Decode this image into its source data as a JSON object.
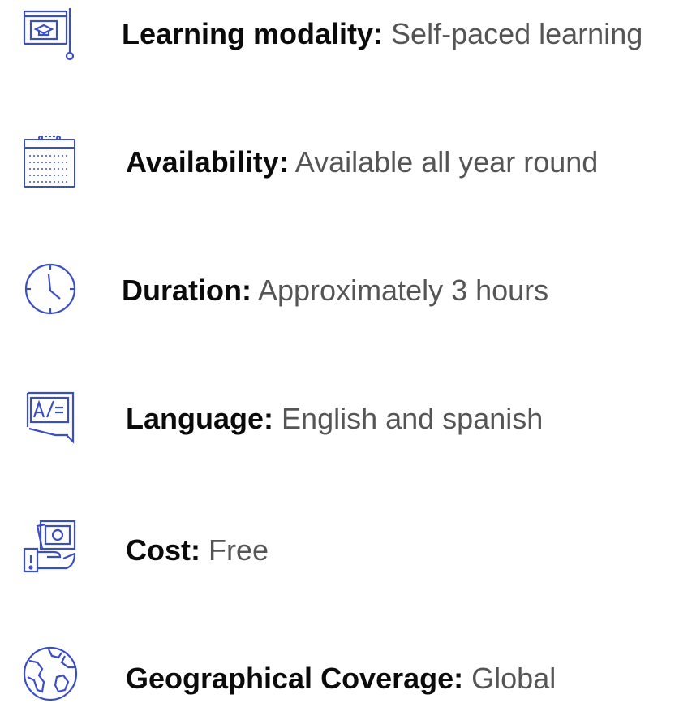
{
  "accent_color": "#3a4fc4",
  "items": [
    {
      "icon": "certificate-screen-icon",
      "label": "Learning modality:",
      "value": "Self-paced learning"
    },
    {
      "icon": "calendar-icon",
      "label": "Availability:",
      "value": "Available all year round"
    },
    {
      "icon": "clock-icon",
      "label": "Duration:",
      "value": "Approximately 3 hours"
    },
    {
      "icon": "translation-icon",
      "label": "Language:",
      "value": "English and spanish"
    },
    {
      "icon": "money-hand-icon",
      "label": "Cost:",
      "value": "Free"
    },
    {
      "icon": "globe-icon",
      "label": "Geographical Coverage:",
      "value": "Global"
    }
  ]
}
